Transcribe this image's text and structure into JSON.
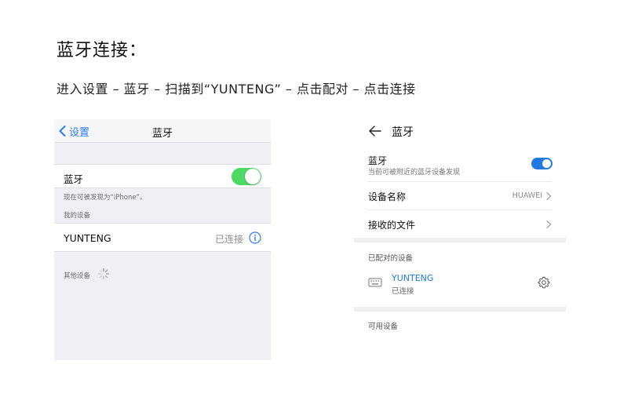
{
  "heading": "蓝牙连接：",
  "steps": "进入设置 – 蓝牙 – 扫描到“YUNTENG” – 点击配对  – 点击连接",
  "ios": {
    "back_label": "设置",
    "title": "蓝牙",
    "bluetooth_label": "蓝牙",
    "bluetooth_on": true,
    "discoverable_note": "现在可被发现为“iPhone”。",
    "my_devices_header": "我的设备",
    "device_name": "YUNTENG",
    "device_status": "已连接",
    "other_devices_header": "其他设备",
    "colors": {
      "accent": "#2f7cf6",
      "toggle_on": "#4cd964",
      "background": "#efeff4"
    }
  },
  "android": {
    "title": "蓝牙",
    "bluetooth_label": "蓝牙",
    "bluetooth_desc": "当前可被附近的蓝牙设备发现",
    "bluetooth_on": true,
    "device_name_label": "设备名称",
    "device_name_value": "HUAWEI",
    "received_files_label": "接收的文件",
    "paired_header": "已配对的设备",
    "paired_device_name": "YUNTENG",
    "paired_device_status": "已连接",
    "available_header": "可用设备",
    "colors": {
      "accent": "#1f7ae0",
      "divider": "#f0f0f0"
    }
  },
  "icons": {
    "ios_back": "chevron-left-icon",
    "ios_info": "info-circle-icon",
    "ios_spinner": "spinner-icon",
    "android_back": "arrow-left-icon",
    "android_chevron": "chevron-right-icon",
    "android_device": "keyboard-icon",
    "android_settings": "gear-icon"
  }
}
